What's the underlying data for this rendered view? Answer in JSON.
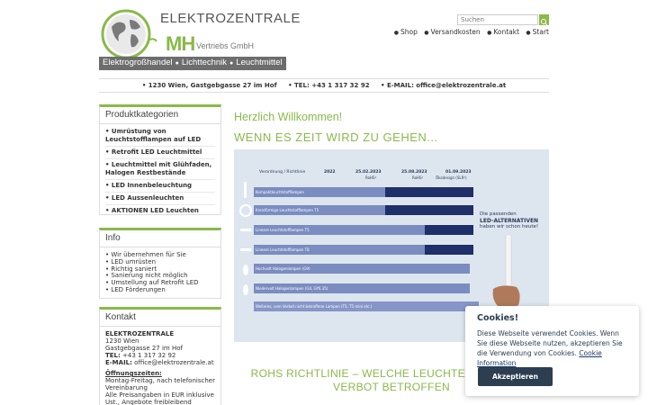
{
  "header": {
    "brand": "ELEKTROZENTRALE",
    "brand_mh": "MH",
    "brand_sub": "Vertriebs GmbH",
    "tagline": [
      "Elektrogroßhandel",
      "Lichttechnik",
      "Leuchtmittel"
    ],
    "search_placeholder": "Suchen",
    "nav": [
      "Shop",
      "Versandkosten",
      "Kontakt",
      "Start"
    ]
  },
  "infobar": {
    "address": "1230 Wien, Gastgebgasse 27 im Hof",
    "tel": "TEL: +43 1 317 32 92",
    "email": "E-MAIL: office@elektrozentrale.at"
  },
  "sidebar": {
    "categories_title": "Produktkategorien",
    "categories": [
      "Umrüstung von Leuchtstofflampen auf LED",
      "Retrofit LED Leuchtmittel",
      "Leuchtmittel mit Glühfaden, Halogen Restbestände",
      "LED Innenbeleuchtung",
      "LED Aussenleuchten",
      "AKTIONEN LED Leuchten"
    ],
    "info_title": "Info",
    "info": [
      "Wir übernehmen für Sie",
      "LED umrüsten",
      "Richtig saniert",
      "Sanierung nicht möglich",
      "Umstellung auf Retrofit LED",
      "LED Förderungen"
    ],
    "contact_title": "Kontakt",
    "contact": {
      "name": "ELEKTROZENTRALE",
      "city": "1230 Wien",
      "street": "Gastgebgasse 27 im Hof",
      "tel_label": "TEL:",
      "tel": "+43 1 317 32 92",
      "email_label": "E-MAIL:",
      "email": "office@elektrozentrale.at",
      "hours_label": "Öffnungszeiten:",
      "hours_1": "Montag-Freitag, nach telefonischer Vereinbarung",
      "hours_2": "Alle Preisangaben in EUR inklusive Ust., Angebote freibleibend"
    }
  },
  "main": {
    "welcome": "Herzlich Willkommen!",
    "headline": "WENN ES ZEIT WIRD ZU GEHEN...",
    "graphic": {
      "col_header": "Verordnung / Richtlinie",
      "years": [
        "2022",
        "25.02.2023",
        "25.08.2023",
        "01.09.2023"
      ],
      "sub_years": [
        "RoHS¹",
        "RoHS¹",
        "Ökodesign (SLR²)"
      ],
      "rows": [
        "Kompaktleuchtstofflampen",
        "Kreisförmige Leuchtstofflampen T5",
        "Lineare Leuchtstofflampen T5",
        "Lineare Leuchtstofflampen T8",
        "Hochvolt Halogenlampen (G9)",
        "Niedervolt Halogenlampen (G4, GY6.35)",
        "Weiteres, vom Verbot nicht betroffene Lampen (T5, T5 mini etc.)"
      ],
      "callout": [
        "Die passenden",
        "LED-ALTERNATIVEN",
        "haben wir schon heute!"
      ]
    },
    "bottom_headline": "ROHS RICHTLINIE – WELCHE LEUCHTEN SIND VOM VERBOT BETROFFEN"
  },
  "cookie": {
    "title": "Cookies!",
    "text": "Diese Webseite verwendet Cookies. Wenn Sie diese Webseite nutzen, akzeptieren Sie die Verwendung von Cookies.",
    "link": "Cookie Information",
    "button": "Akzeptieren"
  },
  "colors": {
    "accent": "#8ab94a",
    "dark_blue": "#1f2f6a",
    "light_blue": "#7a8cc0",
    "cookie_button": "#2c3e50"
  }
}
